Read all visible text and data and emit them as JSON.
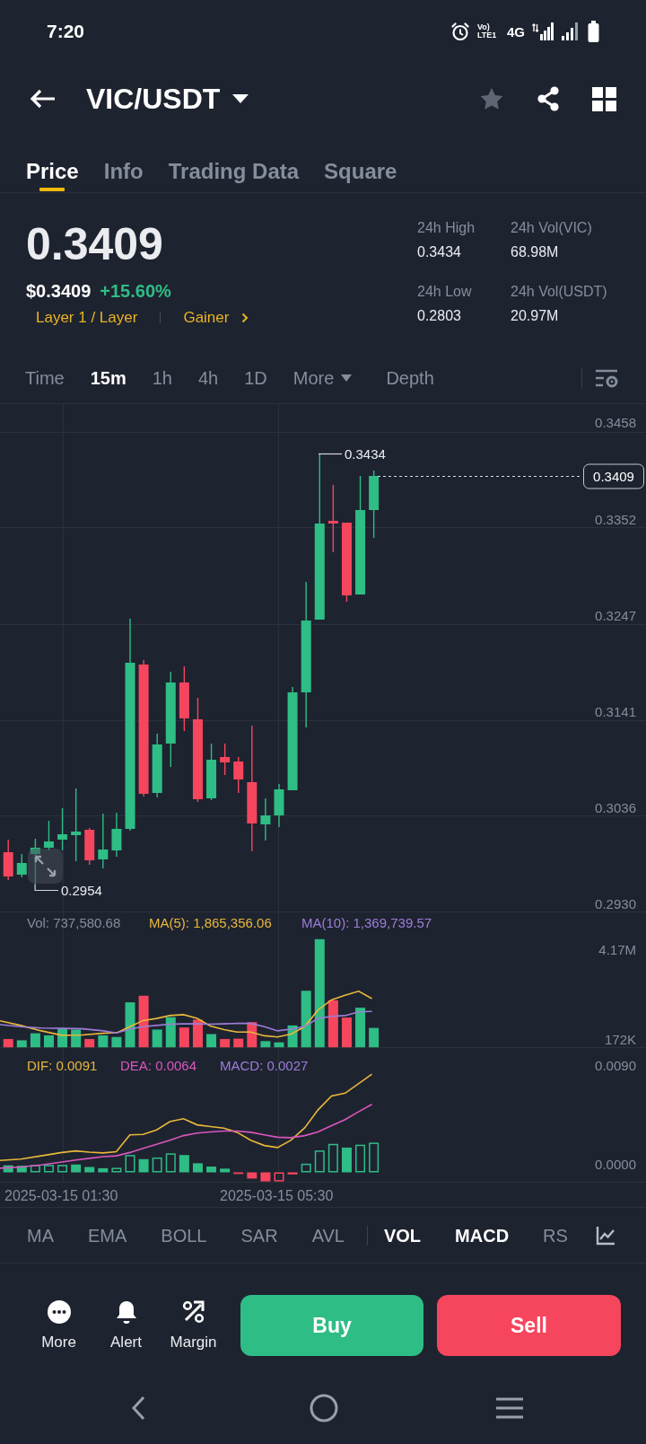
{
  "status_bar": {
    "time": "7:20",
    "volte": "Vo) LTE1",
    "network": "4G"
  },
  "header": {
    "pair": "VIC/USDT",
    "favorited": false
  },
  "tabs": [
    {
      "label": "Price",
      "selected": true
    },
    {
      "label": "Info",
      "selected": false
    },
    {
      "label": "Trading Data",
      "selected": false
    },
    {
      "label": "Square",
      "selected": false
    }
  ],
  "ticker": {
    "last_price": "0.3409",
    "usd_price": "$0.3409",
    "change": "+15.60%",
    "tags": [
      {
        "label": "Layer 1 / Layer",
        "kind": "category"
      },
      {
        "label": "Gainer",
        "kind": "ranking"
      }
    ]
  },
  "stats": [
    {
      "label": "24h High",
      "value": "0.3434"
    },
    {
      "label": "24h Vol(VIC)",
      "value": "68.98M"
    },
    {
      "label": "24h Low",
      "value": "0.2803"
    },
    {
      "label": "24h Vol(USDT)",
      "value": "20.97M"
    }
  ],
  "intervals": [
    {
      "label": "Time",
      "kind": "option",
      "selected": false
    },
    {
      "label": "15m",
      "kind": "option",
      "selected": true
    },
    {
      "label": "1h",
      "kind": "option",
      "selected": false
    },
    {
      "label": "4h",
      "kind": "option",
      "selected": false
    },
    {
      "label": "1D",
      "kind": "option",
      "selected": false
    },
    {
      "label": "More",
      "kind": "menu",
      "selected": false
    },
    {
      "label": "Depth",
      "kind": "view",
      "selected": false
    }
  ],
  "chart": {
    "price_labels": [
      "0.3458",
      "0.3352",
      "0.3247",
      "0.3141",
      "0.3036",
      "0.2930"
    ],
    "high_label": "0.3434",
    "low_label": "0.2954",
    "last_price_label": "0.3409"
  },
  "volume": {
    "legend": [
      {
        "label": "Vol: 737,580.68",
        "color": "#848e9c"
      },
      {
        "label": "MA(5): 1,865,356.06",
        "color": "#e9b83a"
      },
      {
        "label": "MA(10): 1,369,739.57",
        "color": "#9c7ed8"
      }
    ],
    "axis_labels": [
      "4.17M",
      "172K"
    ]
  },
  "macd": {
    "legend": [
      {
        "label": "DIF: 0.0091",
        "color": "#e9b83a"
      },
      {
        "label": "DEA: 0.0064",
        "color": "#d957bd"
      },
      {
        "label": "MACD: 0.0027",
        "color": "#9c7ed8"
      }
    ],
    "axis_labels": [
      "0.0090",
      "0.0000"
    ]
  },
  "time_labels": [
    "2025-03-15 01:30",
    "2025-03-15 05:30"
  ],
  "indicators": {
    "main": [
      {
        "label": "MA",
        "selected": false
      },
      {
        "label": "EMA",
        "selected": false
      },
      {
        "label": "BOLL",
        "selected": false
      },
      {
        "label": "SAR",
        "selected": false
      },
      {
        "label": "AVL",
        "selected": false
      }
    ],
    "sub": [
      {
        "label": "VOL",
        "selected": true
      },
      {
        "label": "MACD",
        "selected": true
      },
      {
        "label": "RS",
        "selected": false
      }
    ]
  },
  "actions": [
    {
      "label": "More",
      "kind": "more"
    },
    {
      "label": "Alert",
      "kind": "alert"
    },
    {
      "label": "Margin",
      "kind": "margin"
    }
  ],
  "trade": [
    {
      "label": "Buy",
      "kind": "buy"
    },
    {
      "label": "Sell",
      "kind": "sell"
    }
  ]
}
